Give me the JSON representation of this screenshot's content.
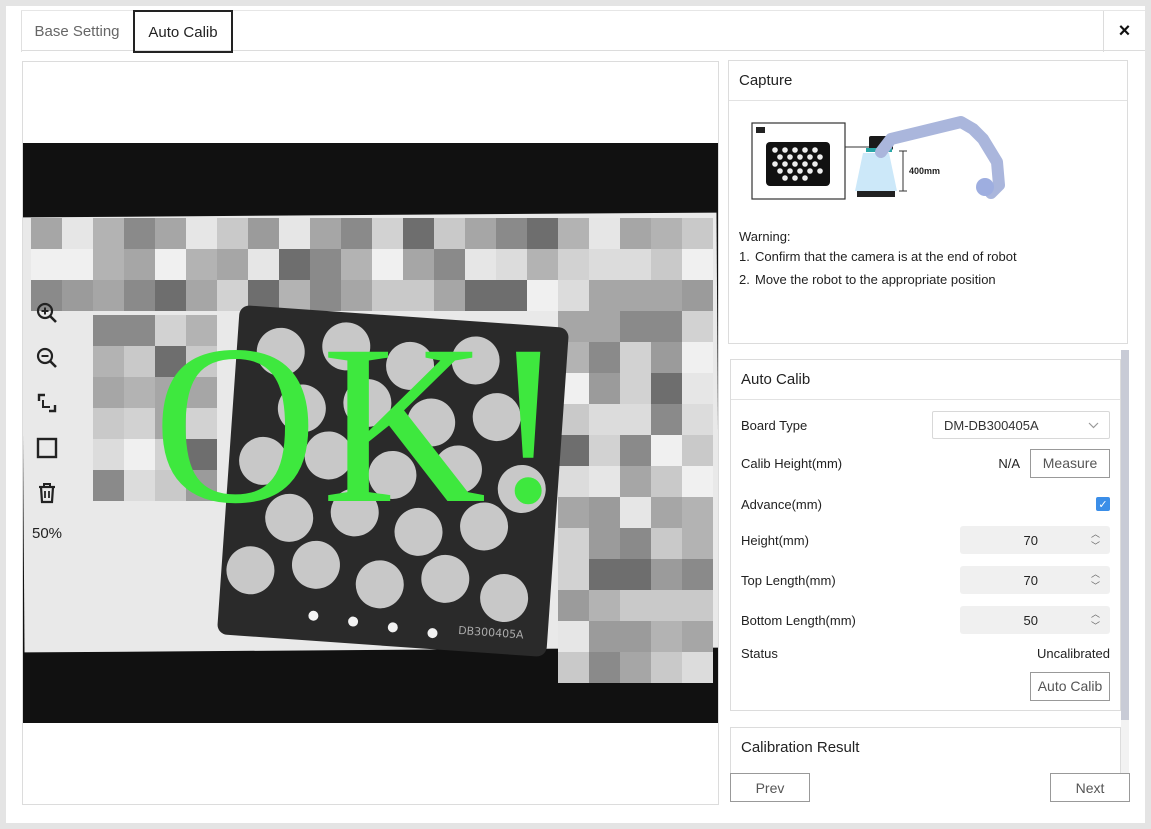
{
  "tabs": {
    "base_setting": "Base Setting",
    "auto_calib": "Auto Calib"
  },
  "close_glyph": "×",
  "viewer": {
    "overlay_text": "OK!",
    "board_label": "DB300405A",
    "zoom_level": "50%"
  },
  "capture": {
    "title": "Capture",
    "diagram_distance": "400mm",
    "warning_label": "Warning:",
    "warnings": [
      {
        "num": "1.",
        "text": "Confirm that the camera is at the end of robot"
      },
      {
        "num": "2.",
        "text": "Move the robot to the appropriate position"
      }
    ]
  },
  "auto_calib": {
    "title": "Auto Calib",
    "board_type_label": "Board Type",
    "board_type_value": "DM-DB300405A",
    "calib_height_label": "Calib Height(mm)",
    "calib_height_value": "N/A",
    "measure_button": "Measure",
    "advance_label": "Advance(mm)",
    "advance_checked": true,
    "height_label": "Height(mm)",
    "height_value": "70",
    "top_length_label": "Top Length(mm)",
    "top_length_value": "70",
    "bottom_length_label": "Bottom Length(mm)",
    "bottom_length_value": "50",
    "status_label": "Status",
    "status_value": "Uncalibrated",
    "auto_calib_button": "Auto Calib"
  },
  "calibration_result": {
    "title": "Calibration Result"
  },
  "nav": {
    "prev": "Prev",
    "next": "Next"
  },
  "colors": {
    "ok_green": "#3ee83e",
    "checkbox_blue": "#3b8ee8"
  }
}
